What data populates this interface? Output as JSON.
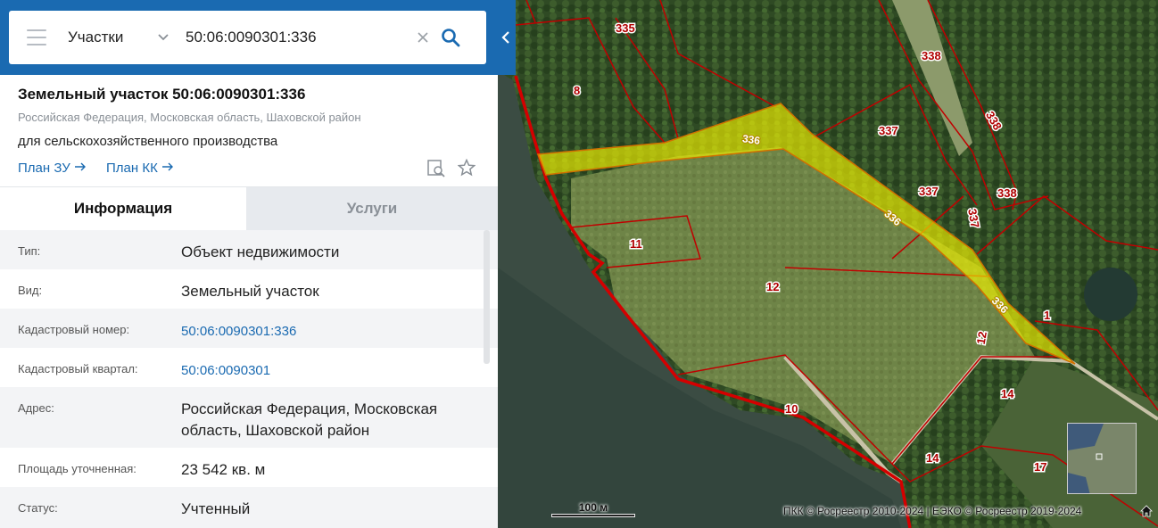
{
  "search": {
    "layer": "Участки",
    "query": "50:06:0090301:336"
  },
  "object": {
    "title": "Земельный участок 50:06:0090301:336",
    "address": "Российская Федерация, Московская область, Шаховской район",
    "purpose": "для сельскохозяйственного производства",
    "links": [
      "План ЗУ",
      "План КК"
    ]
  },
  "tabs": [
    "Информация",
    "Услуги"
  ],
  "info": [
    {
      "key": "Тип:",
      "value": "Объект недвижимости",
      "link": false
    },
    {
      "key": "Вид:",
      "value": "Земельный участок",
      "link": false
    },
    {
      "key": "Кадастровый номер:",
      "value": "50:06:0090301:336",
      "link": true
    },
    {
      "key": "Кадастровый квартал:",
      "value": "50:06:0090301",
      "link": true
    },
    {
      "key": "Адрес:",
      "value": "Российская Федерация, Московская область, Шаховской район",
      "link": false
    },
    {
      "key": "Площадь уточненная:",
      "value": "23 542 кв. м",
      "link": false
    },
    {
      "key": "Статус:",
      "value": "Учтенный",
      "link": false
    }
  ],
  "map": {
    "scale_label": "100 м",
    "attribution": "ПКК © Росреестр 2010-2024 | ЕЭКО © Росреестр 2019-2024",
    "parcel_labels": [
      "335",
      "8",
      "338",
      "337",
      "336",
      "11",
      "12",
      "1",
      "14",
      "10",
      "17"
    ],
    "colors": {
      "accent": "#1a6ab1",
      "highlight": "#f2f200",
      "boundary": "#d40000"
    }
  }
}
